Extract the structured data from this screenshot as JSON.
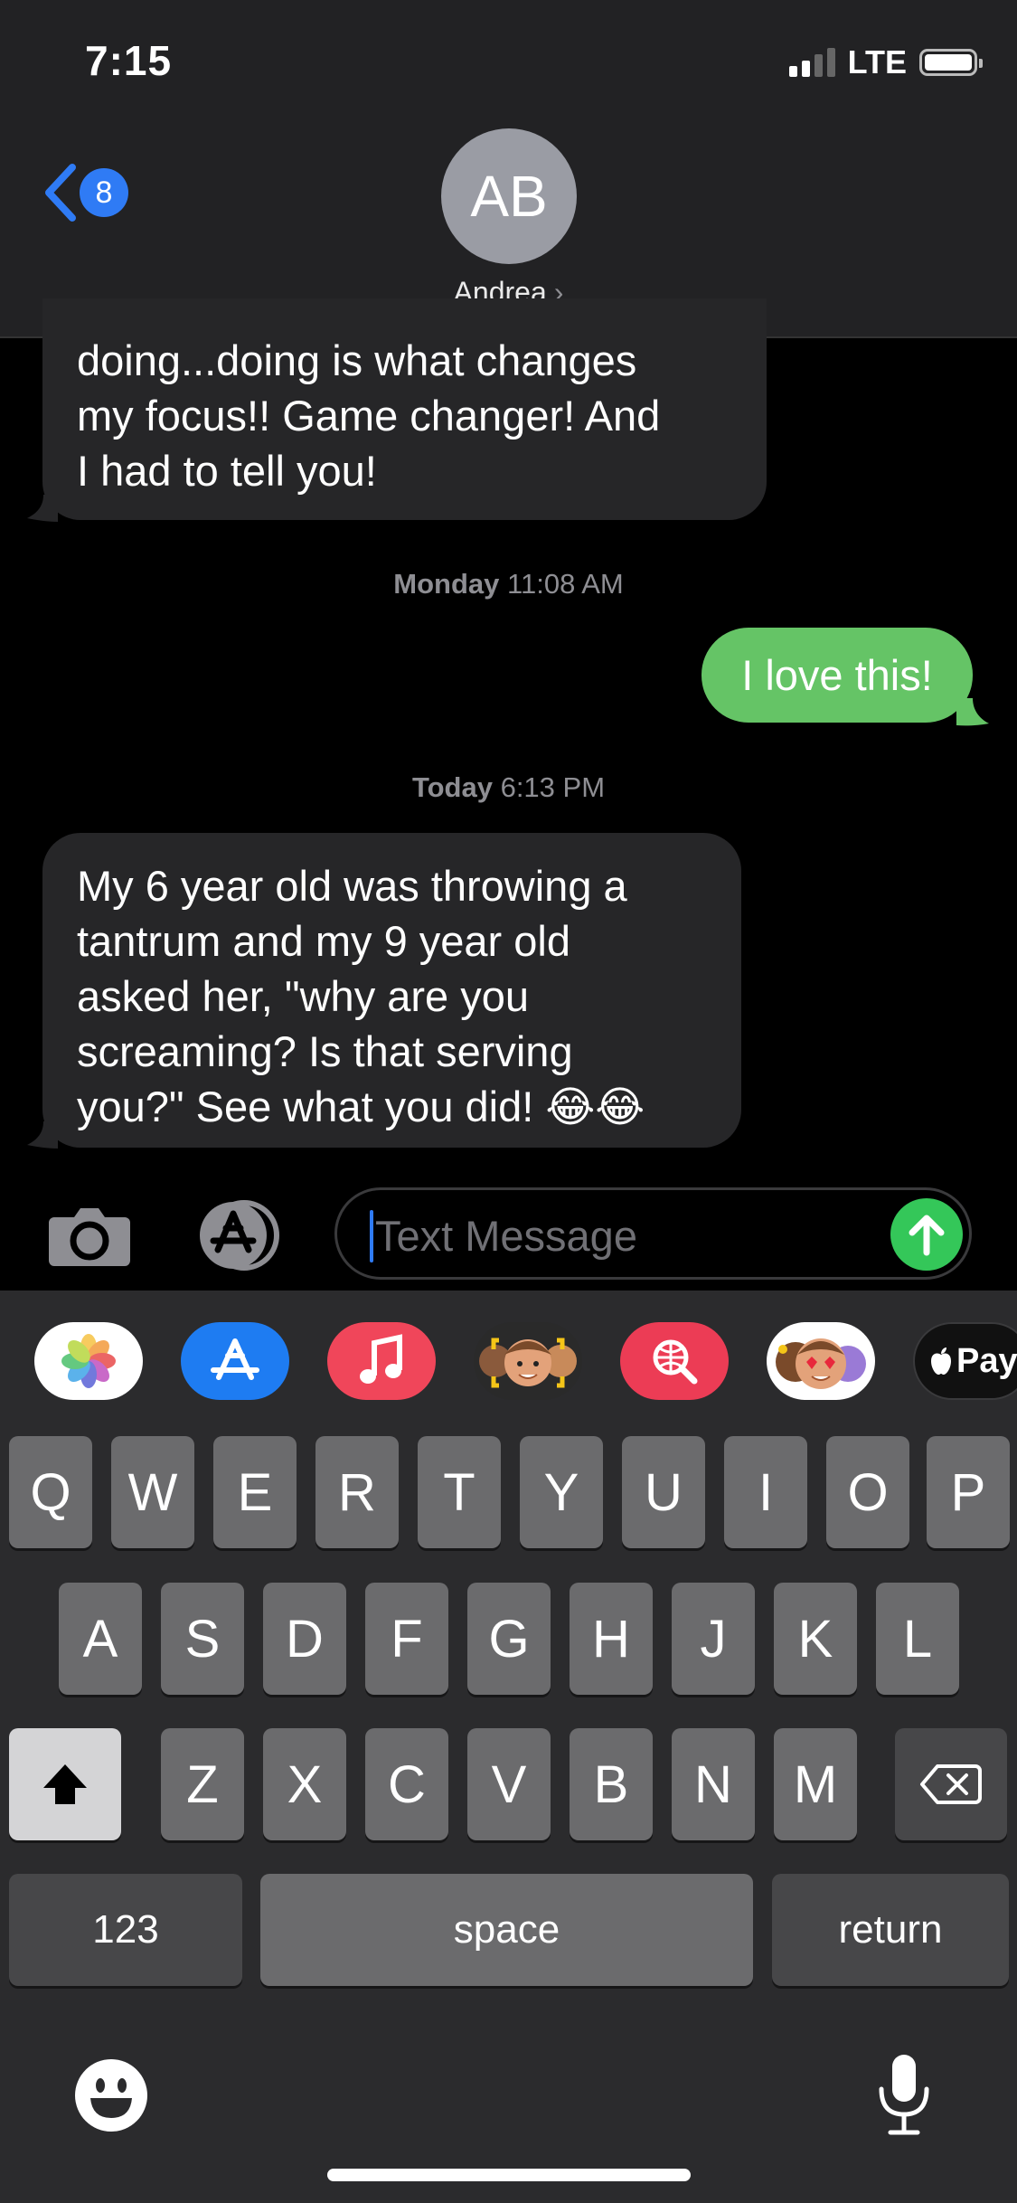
{
  "status_bar": {
    "time": "7:15",
    "network": "LTE"
  },
  "header": {
    "back_badge": "8",
    "avatar_initials": "AB",
    "contact_name": "Andrea",
    "contact_chevron": "›"
  },
  "messages": [
    {
      "direction": "incoming",
      "text_lines": [
        "doing...doing is what changes",
        "my focus!! Game changer! And",
        "I had to tell you!"
      ]
    },
    {
      "type": "timestamp",
      "day": "Monday",
      "time": "11:08 AM"
    },
    {
      "direction": "outgoing",
      "text": "I love this!"
    },
    {
      "type": "timestamp",
      "day": "Today",
      "time": "6:13 PM"
    },
    {
      "direction": "incoming",
      "text_lines": [
        "My 6 year old was throwing a",
        "tantrum and my 9 year old",
        "asked her, \"why are you",
        "screaming? Is that serving",
        "you?\" See what you did! 😂😂"
      ]
    }
  ],
  "input": {
    "placeholder": "Text Message"
  },
  "app_strip": [
    "photos-icon",
    "app-store-icon",
    "music-icon",
    "memoji-camera-icon",
    "web-search-icon",
    "memoji-stickers-icon",
    "apple-pay-icon"
  ],
  "apple_pay_label": "Pay",
  "keyboard": {
    "row1": [
      "Q",
      "W",
      "E",
      "R",
      "T",
      "Y",
      "U",
      "I",
      "O",
      "P"
    ],
    "row2": [
      "A",
      "S",
      "D",
      "F",
      "G",
      "H",
      "J",
      "K",
      "L"
    ],
    "row3": [
      "Z",
      "X",
      "C",
      "V",
      "B",
      "N",
      "M"
    ],
    "numbers_label": "123",
    "space_label": "space",
    "return_label": "return"
  },
  "colors": {
    "outgoing_bubble": "#65c466",
    "incoming_bubble": "#262628",
    "accent": "#2f7bf5",
    "send": "#34c759"
  }
}
